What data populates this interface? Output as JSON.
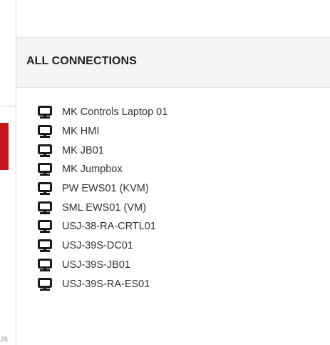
{
  "left_sidebar": {
    "fragment": "26"
  },
  "panel": {
    "title": "ALL CONNECTIONS",
    "connections": [
      {
        "label": "MK Controls Laptop 01",
        "icon": "desktop-icon"
      },
      {
        "label": "MK HMI",
        "icon": "desktop-icon"
      },
      {
        "label": "MK JB01",
        "icon": "desktop-icon"
      },
      {
        "label": "MK Jumpbox",
        "icon": "desktop-icon"
      },
      {
        "label": "PW EWS01 (KVM)",
        "icon": "desktop-icon"
      },
      {
        "label": "SML EWS01 (VM)",
        "icon": "desktop-icon"
      },
      {
        "label": "USJ-38-RA-CRTL01",
        "icon": "desktop-icon"
      },
      {
        "label": "USJ-39S-DC01",
        "icon": "desktop-icon"
      },
      {
        "label": "USJ-39S-JB01",
        "icon": "desktop-icon"
      },
      {
        "label": "USJ-39S-RA-ES01",
        "icon": "desktop-icon"
      }
    ]
  },
  "colors": {
    "accent_red": "#c9161d",
    "icon_color": "#1a1a1a",
    "text_color": "#333333",
    "header_bg": "#f5f5f5"
  }
}
